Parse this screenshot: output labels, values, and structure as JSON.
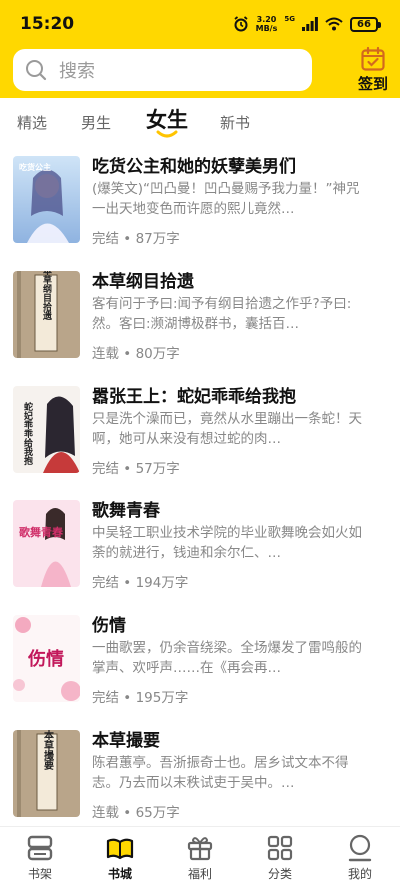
{
  "status_bar": {
    "time": "15:20",
    "net_speed_value": "3.20",
    "net_speed_unit": "MB/s",
    "signal_label": "5G",
    "battery": "66"
  },
  "search": {
    "placeholder": "搜索"
  },
  "checkin": {
    "label": "签到"
  },
  "tabs": [
    {
      "label": "精选"
    },
    {
      "label": "男生"
    },
    {
      "label": "女生",
      "active": true
    },
    {
      "label": "新书"
    }
  ],
  "books": [
    {
      "title": "吃货公主和她的妖孽美男们",
      "description": "(爆笑文)“凹凸曼！凹凸曼赐予我力量！”神咒一出天地变色而许愿的熙儿竟然…",
      "status": "完结",
      "word_count": "87万字"
    },
    {
      "title": "本草纲目拾遗",
      "description": "客有问于予曰:闻予有纲目拾遗之作乎?予曰:然。客曰:濒湖博极群书，囊括百…",
      "status": "连载",
      "word_count": "80万字"
    },
    {
      "title": "嚣张王上：蛇妃乖乖给我抱",
      "description": "只是洗个澡而已，竟然从水里蹦出一条蛇！天啊，她可从来没有想过蛇的肉…",
      "status": "完结",
      "word_count": "57万字"
    },
    {
      "title": "歌舞青春",
      "description": "中吴轻工职业技术学院的毕业歌舞晚会如火如荼的就进行，钱迪和余尔仁、…",
      "status": "完结",
      "word_count": "194万字"
    },
    {
      "title": "伤情",
      "description": "一曲歌罢，仍余音绕梁。全场爆发了雷鸣般的掌声、欢呼声……在《再会再…",
      "status": "完结",
      "word_count": "195万字"
    },
    {
      "title": "本草撮要",
      "description": "陈君蕙亭。吾浙振奇士也。居乡试文本不得志。乃去而以末秩试吏于吴中。…",
      "status": "连载",
      "word_count": "65万字"
    }
  ],
  "meta_separator": "•",
  "covers": {
    "book1_text": "吃货公主",
    "book2_text": "本草纲目拾遗",
    "book3_text": "蛇妃乖乖给我抱",
    "book4_text": "歌舞青春",
    "book5_text": "伤情",
    "book6_text": "本草撮要"
  },
  "bottom_nav": [
    {
      "label": "书架",
      "icon": "bookshelf-icon"
    },
    {
      "label": "书城",
      "icon": "bookstore-icon",
      "active": true
    },
    {
      "label": "福利",
      "icon": "gift-icon"
    },
    {
      "label": "分类",
      "icon": "category-icon"
    },
    {
      "label": "我的",
      "icon": "profile-icon"
    }
  ],
  "colors": {
    "accent": "#ffd800",
    "text_primary": "#111111",
    "text_secondary": "#888888"
  }
}
